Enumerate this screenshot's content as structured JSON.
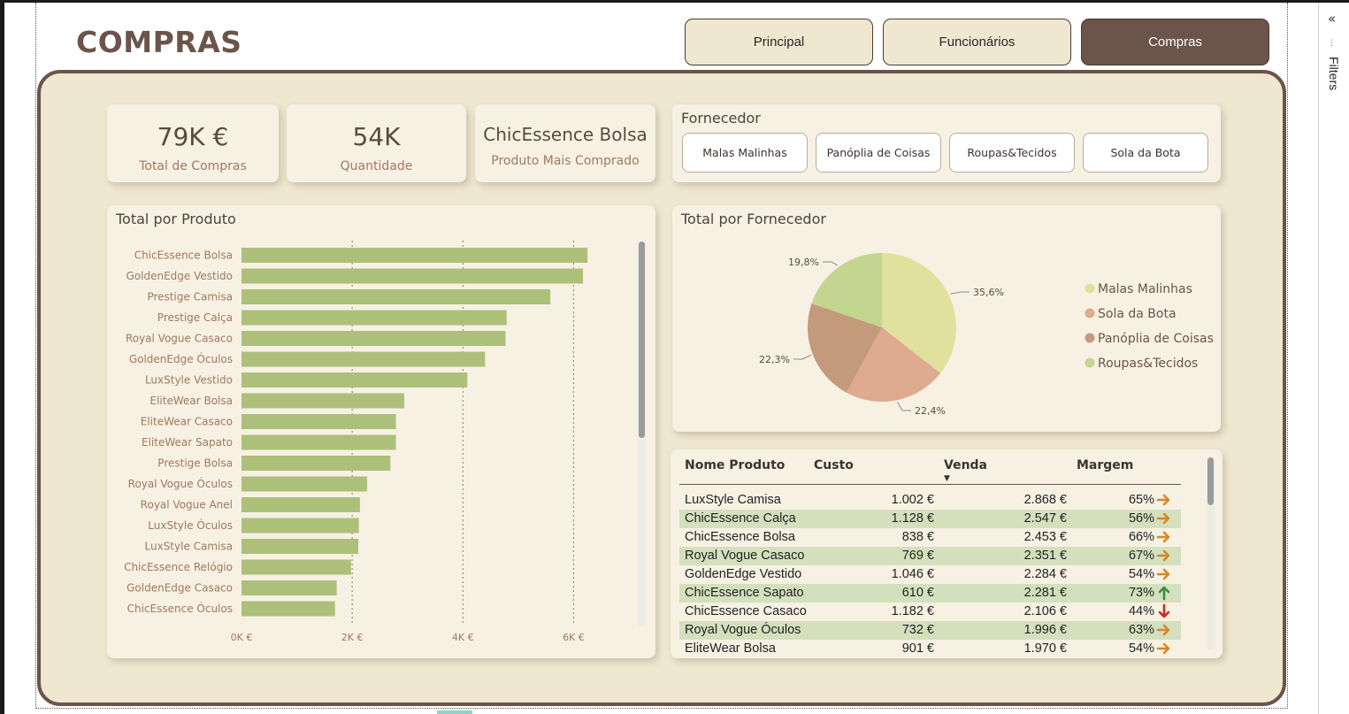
{
  "page": {
    "title": "COMPRAS"
  },
  "nav": {
    "buttons": [
      {
        "label": "Principal",
        "active": false
      },
      {
        "label": "Funcionários",
        "active": false
      },
      {
        "label": "Compras",
        "active": true
      }
    ]
  },
  "kpis": {
    "total_compras": {
      "value": "79K €",
      "label": "Total de Compras"
    },
    "quantidade": {
      "value": "54K",
      "label": "Quantidade"
    },
    "produto_top": {
      "value": "ChicEssence Bolsa",
      "label": "Produto Mais Comprado"
    }
  },
  "fornecedor_slicer": {
    "title": "Fornecedor",
    "options": [
      "Malas Malinhas",
      "Panóplia de Coisas",
      "Roupas&Tecidos",
      "Sola da Bota"
    ]
  },
  "colors": {
    "brand_brown": "#6b5449",
    "panel_bg": "#efe7d0",
    "bar_green": "#adc07a",
    "row_highlight": "#d4e0bd",
    "arrow_orange": "#d4882a",
    "arrow_green": "#3b8a4a",
    "arrow_red": "#d02a1e"
  },
  "chart_data": [
    {
      "type": "bar",
      "orientation": "horizontal",
      "title": "Total por Produto",
      "categories": [
        "ChicEssence Bolsa",
        "GoldenEdge Vestido",
        "Prestige Camisa",
        "Prestige Calça",
        "Royal Vogue Casaco",
        "GoldenEdge Óculos",
        "LuxStyle Vestido",
        "EliteWear Bolsa",
        "EliteWear Casaco",
        "EliteWear Sapato",
        "Prestige Bolsa",
        "Royal Vogue Óculos",
        "Royal Vogue Anel",
        "LuxStyle Óculos",
        "LuxStyle Camisa",
        "ChicEssence Relógio",
        "GoldenEdge Casaco",
        "ChicEssence Óculos"
      ],
      "values": [
        6250,
        6170,
        5580,
        4790,
        4770,
        4400,
        4080,
        2940,
        2790,
        2790,
        2690,
        2270,
        2140,
        2120,
        2110,
        1980,
        1720,
        1690
      ],
      "xlim": [
        0,
        7000
      ],
      "x_ticks": [
        "0K €",
        "2K €",
        "4K €",
        "6K €"
      ],
      "x_tick_values": [
        0,
        2000,
        4000,
        6000
      ],
      "grid": true,
      "color": "#adc07a"
    },
    {
      "type": "pie",
      "title": "Total por Fornecedor",
      "labels": [
        "Malas Malinhas",
        "Sola da Bota",
        "Panóplia de Coisas",
        "Roupas&Tecidos"
      ],
      "values": [
        35.6,
        22.4,
        22.3,
        19.8
      ],
      "value_labels": [
        "35,6%",
        "22,4%",
        "22,3%",
        "19,8%"
      ],
      "colors": [
        "#e1e19e",
        "#deaa90",
        "#c49a7c",
        "#c3d690"
      ],
      "legend": "right"
    }
  ],
  "table": {
    "headers": [
      "Nome Produto",
      "Custo",
      "Venda",
      "Margem"
    ],
    "sort_column": "Venda",
    "rows": [
      {
        "name": "LuxStyle Camisa",
        "custo": "1.002 €",
        "venda": "2.868 €",
        "margem": "65%",
        "trend": "right"
      },
      {
        "name": "ChicEssence Calça",
        "custo": "1.128 €",
        "venda": "2.547 €",
        "margem": "56%",
        "trend": "right"
      },
      {
        "name": "ChicEssence Bolsa",
        "custo": "838 €",
        "venda": "2.453 €",
        "margem": "66%",
        "trend": "right"
      },
      {
        "name": "Royal Vogue Casaco",
        "custo": "769 €",
        "venda": "2.351 €",
        "margem": "67%",
        "trend": "right"
      },
      {
        "name": "GoldenEdge Vestido",
        "custo": "1.046 €",
        "venda": "2.284 €",
        "margem": "54%",
        "trend": "right"
      },
      {
        "name": "ChicEssence Sapato",
        "custo": "610 €",
        "venda": "2.281 €",
        "margem": "73%",
        "trend": "up"
      },
      {
        "name": "ChicEssence Casaco",
        "custo": "1.182 €",
        "venda": "2.106 €",
        "margem": "44%",
        "trend": "down"
      },
      {
        "name": "Royal Vogue Óculos",
        "custo": "732 €",
        "venda": "1.996 €",
        "margem": "63%",
        "trend": "right"
      },
      {
        "name": "EliteWear Bolsa",
        "custo": "901 €",
        "venda": "1.970 €",
        "margem": "54%",
        "trend": "right"
      }
    ]
  },
  "filters_pane": {
    "label": "Filters"
  }
}
